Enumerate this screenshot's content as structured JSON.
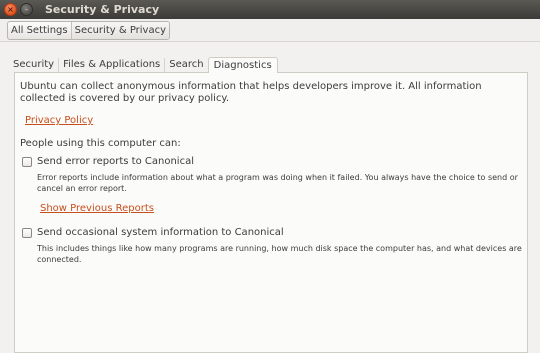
{
  "window": {
    "title": "Security & Privacy",
    "close_glyph": "×",
    "minimize_glyph": "–"
  },
  "breadcrumb": {
    "items": [
      "All Settings",
      "Security & Privacy"
    ]
  },
  "tabs": [
    "Security",
    "Files & Applications",
    "Search",
    "Diagnostics"
  ],
  "selected_tab": "Diagnostics",
  "diagnostics": {
    "intro": "Ubuntu can collect anonymous information that helps developers improve it. All information collected is covered by our privacy policy.",
    "privacy_policy_link": "Privacy Policy",
    "people_label": "People using this computer can:",
    "error_reports": {
      "label": "Send error reports to Canonical",
      "checked": false,
      "description": "Error reports include information about what a program was doing when it failed. You always have the choice to send or cancel an error report.",
      "show_link": "Show Previous Reports"
    },
    "system_info": {
      "label": "Send occasional system information to Canonical",
      "checked": false,
      "description": "This includes things like how many programs are running, how much disk space the computer has, and what devices are connected."
    }
  },
  "colors": {
    "link": "#c84e1c",
    "titlebar": "#3c3b37",
    "close_button": "#e0521f"
  }
}
